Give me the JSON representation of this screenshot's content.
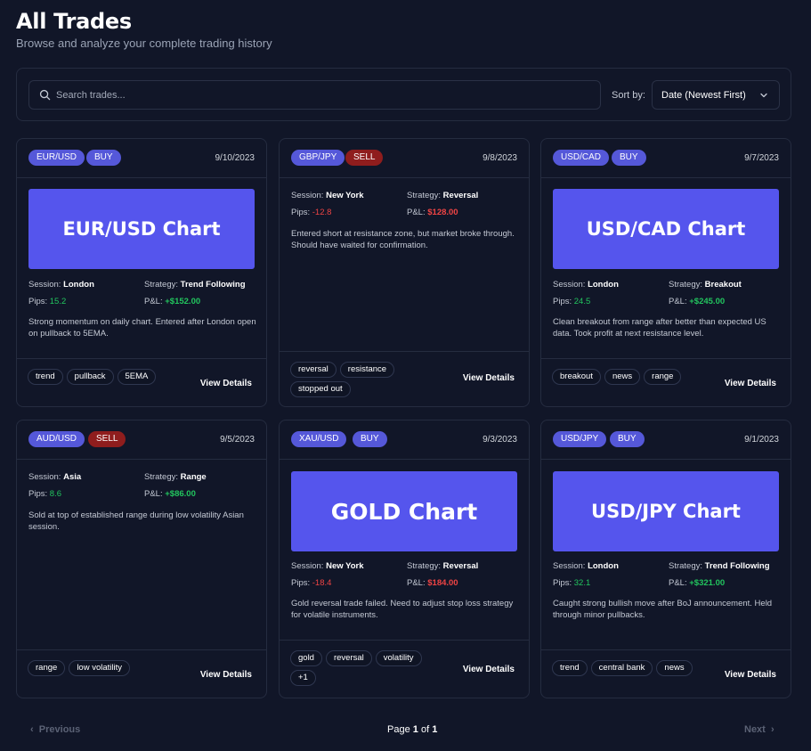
{
  "header": {
    "title": "All Trades",
    "subtitle": "Browse and analyze your complete trading history"
  },
  "filters": {
    "search_placeholder": "Search trades...",
    "sort_label": "Sort by:",
    "sort_value": "Date (Newest First)"
  },
  "labels": {
    "session": "Session:",
    "strategy": "Strategy:",
    "pips": "Pips:",
    "pnl": "P&L:",
    "view_details": "View Details"
  },
  "colors": {
    "background": "#111628",
    "accent": "#5558d9",
    "chart_placeholder": "#5555ed",
    "sell": "#8f1d1d",
    "profit": "#22c55e",
    "loss": "#ef4444"
  },
  "trades": [
    {
      "pair": "EUR/USD",
      "side": "BUY",
      "date": "9/10/2023",
      "chart_label": "EUR/USD Chart",
      "session": "London",
      "strategy": "Trend Following",
      "pips": "15.2",
      "pnl": "+$152.00",
      "notes": "Strong momentum on daily chart. Entered after London open on pullback to 5EMA.",
      "tags": [
        "trend",
        "pullback",
        "5EMA"
      ]
    },
    {
      "pair": "GBP/JPY",
      "side": "SELL",
      "date": "9/8/2023",
      "chart_label": "",
      "session": "New York",
      "strategy": "Reversal",
      "pips": "-12.8",
      "pnl": "$128.00",
      "notes": "Entered short at resistance zone, but market broke through. Should have waited for confirmation.",
      "tags": [
        "reversal",
        "resistance",
        "stopped out"
      ]
    },
    {
      "pair": "USD/CAD",
      "side": "BUY",
      "date": "9/7/2023",
      "chart_label": "USD/CAD Chart",
      "session": "London",
      "strategy": "Breakout",
      "pips": "24.5",
      "pnl": "+$245.00",
      "notes": "Clean breakout from range after better than expected US data. Took profit at next resistance level.",
      "tags": [
        "breakout",
        "news",
        "range"
      ]
    },
    {
      "pair": "AUD/USD",
      "side": "SELL",
      "date": "9/5/2023",
      "chart_label": "",
      "session": "Asia",
      "strategy": "Range",
      "pips": "8.6",
      "pnl": "+$86.00",
      "notes": "Sold at top of established range during low volatility Asian session.",
      "tags": [
        "range",
        "low volatility"
      ]
    },
    {
      "pair": "XAU/USD",
      "side": "BUY",
      "date": "9/3/2023",
      "chart_label": "GOLD Chart",
      "session": "New York",
      "strategy": "Reversal",
      "pips": "-18.4",
      "pnl": "$184.00",
      "notes": "Gold reversal trade failed. Need to adjust stop loss strategy for volatile instruments.",
      "tags": [
        "gold",
        "reversal",
        "volatility",
        "+1"
      ]
    },
    {
      "pair": "USD/JPY",
      "side": "BUY",
      "date": "9/1/2023",
      "chart_label": "USD/JPY Chart",
      "session": "London",
      "strategy": "Trend Following",
      "pips": "32.1",
      "pnl": "+$321.00",
      "notes": "Caught strong bullish move after BoJ announcement. Held through minor pullbacks.",
      "tags": [
        "trend",
        "central bank",
        "news"
      ]
    }
  ],
  "pagination": {
    "previous": "Previous",
    "next": "Next",
    "page_word": "Page",
    "of_word": "of",
    "current": "1",
    "total": "1"
  }
}
